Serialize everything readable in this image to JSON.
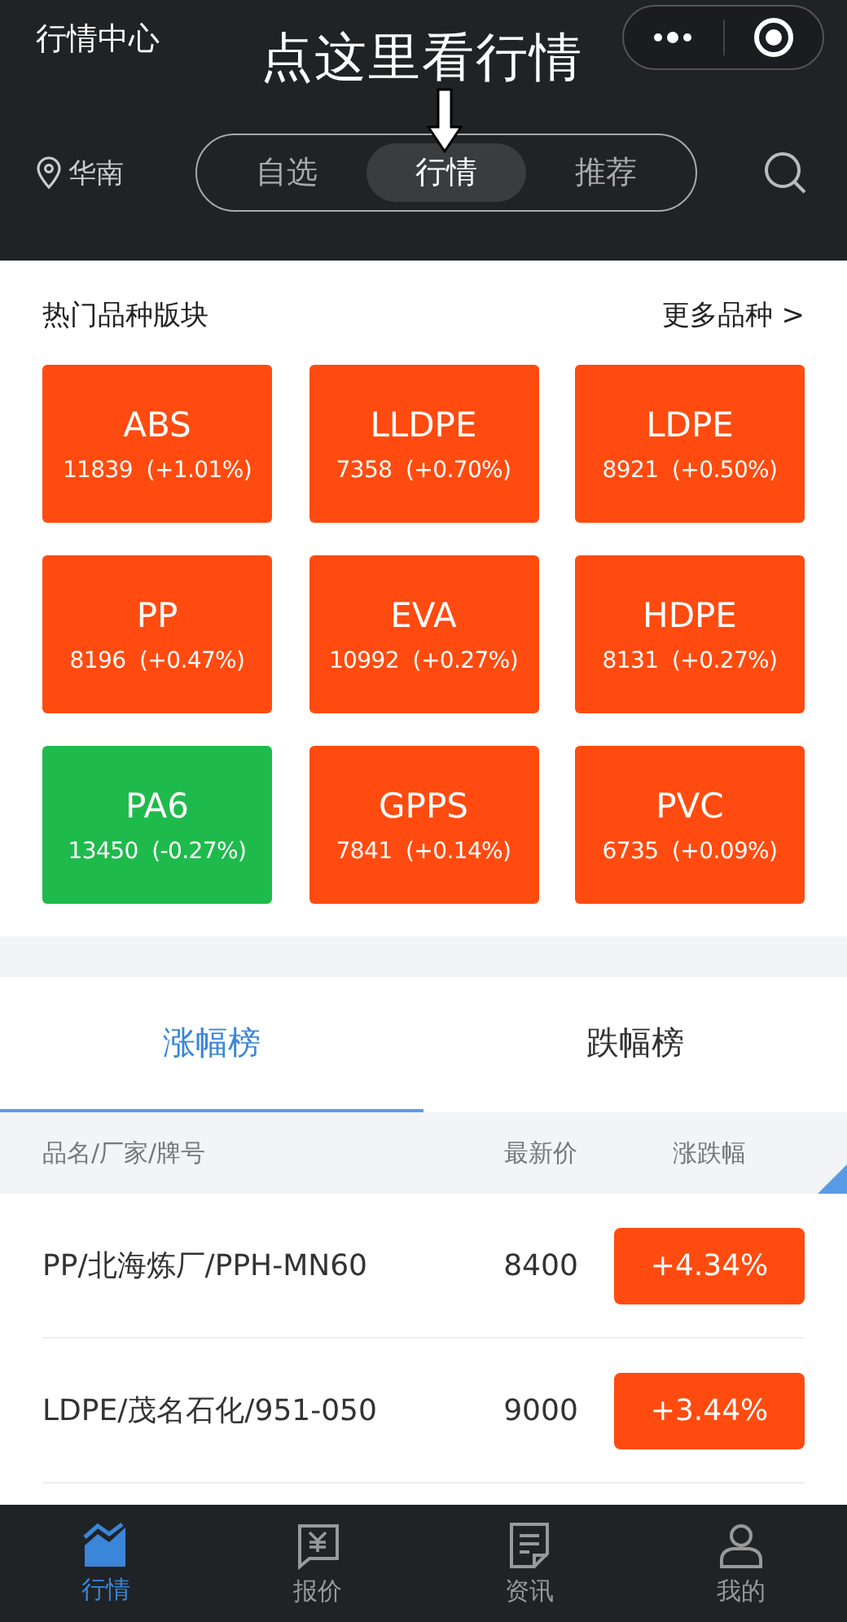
{
  "header": {
    "title": "行情中心",
    "region": "华南",
    "segments": [
      {
        "label": "自选",
        "selected": false
      },
      {
        "label": "行情",
        "selected": true
      },
      {
        "label": "推荐",
        "selected": false
      }
    ]
  },
  "annotation": {
    "text": "点这里看行情"
  },
  "hot": {
    "title": "热门品种版块",
    "more": "更多品种 >",
    "tiles": [
      {
        "name": "ABS",
        "quote": "11839  (+1.01%)",
        "color": "#ff4b0f"
      },
      {
        "name": "LLDPE",
        "quote": "7358  (+0.70%)",
        "color": "#ff4b0f"
      },
      {
        "name": "LDPE",
        "quote": "8921  (+0.50%)",
        "color": "#ff4b0f"
      },
      {
        "name": "PP",
        "quote": "8196  (+0.47%)",
        "color": "#ff4b0f"
      },
      {
        "name": "EVA",
        "quote": "10992  (+0.27%)",
        "color": "#ff4b0f"
      },
      {
        "name": "HDPE",
        "quote": "8131  (+0.27%)",
        "color": "#ff4b0f"
      },
      {
        "name": "PA6",
        "quote": "13450  (-0.27%)",
        "color": "#1fba4c"
      },
      {
        "name": "GPPS",
        "quote": "7841  (+0.14%)",
        "color": "#ff4b0f"
      },
      {
        "name": "PVC",
        "quote": "6735  (+0.09%)",
        "color": "#ff4b0f"
      }
    ]
  },
  "ranking": {
    "tabs": [
      {
        "label": "涨幅榜",
        "selected": true
      },
      {
        "label": "跌幅榜",
        "selected": false
      }
    ],
    "columns": [
      "品名/厂家/牌号",
      "最新价",
      "涨跌幅"
    ],
    "rows": [
      {
        "name": "PP/北海炼厂/PPH-MN60",
        "price": "8400",
        "change": "+4.34%",
        "color": "#ff4b0f"
      },
      {
        "name": "LDPE/茂名石化/951-050",
        "price": "9000",
        "change": "+3.44%",
        "color": "#ff4b0f"
      }
    ]
  },
  "tabbar": [
    {
      "label": "行情",
      "kind": "chart",
      "selected": true
    },
    {
      "label": "报价",
      "kind": "quote",
      "selected": false
    },
    {
      "label": "资讯",
      "kind": "news",
      "selected": false
    },
    {
      "label": "我的",
      "kind": "user",
      "selected": false
    }
  ]
}
